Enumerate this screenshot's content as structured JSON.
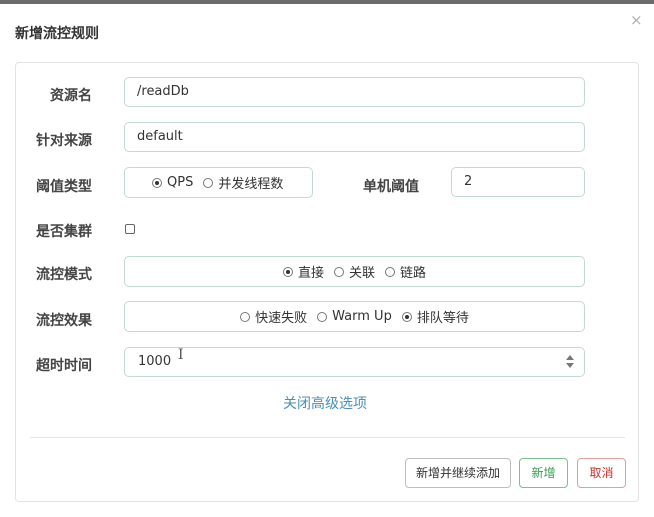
{
  "dialog": {
    "title": "新增流控规则",
    "close_glyph": "×"
  },
  "form": {
    "resource": {
      "label": "资源名",
      "value": "/readDb"
    },
    "limit_app": {
      "label": "针对来源",
      "value": "default"
    },
    "threshold_type": {
      "label": "阈值类型",
      "options": [
        {
          "label": "QPS",
          "selected": true
        },
        {
          "label": "并发线程数",
          "selected": false
        }
      ]
    },
    "single_threshold": {
      "label": "单机阈值",
      "value": "2"
    },
    "cluster": {
      "label": "是否集群",
      "checked": false
    },
    "control_mode": {
      "label": "流控模式",
      "options": [
        {
          "label": "直接",
          "selected": true
        },
        {
          "label": "关联",
          "selected": false
        },
        {
          "label": "链路",
          "selected": false
        }
      ]
    },
    "control_effect": {
      "label": "流控效果",
      "options": [
        {
          "label": "快速失败",
          "selected": false
        },
        {
          "label": "Warm Up",
          "selected": false
        },
        {
          "label": "排队等待",
          "selected": true
        }
      ]
    },
    "timeout": {
      "label": "超时时间",
      "value": "1000"
    },
    "advanced_toggle": "关闭高级选项"
  },
  "buttons": {
    "save_and_continue": "新增并继续添加",
    "add": "新增",
    "cancel": "取消"
  },
  "colors": {
    "input_border": "#c4d9cf",
    "link": "#4a90b5",
    "add_button": "#3a9a52",
    "cancel_button": "#c9302c"
  }
}
